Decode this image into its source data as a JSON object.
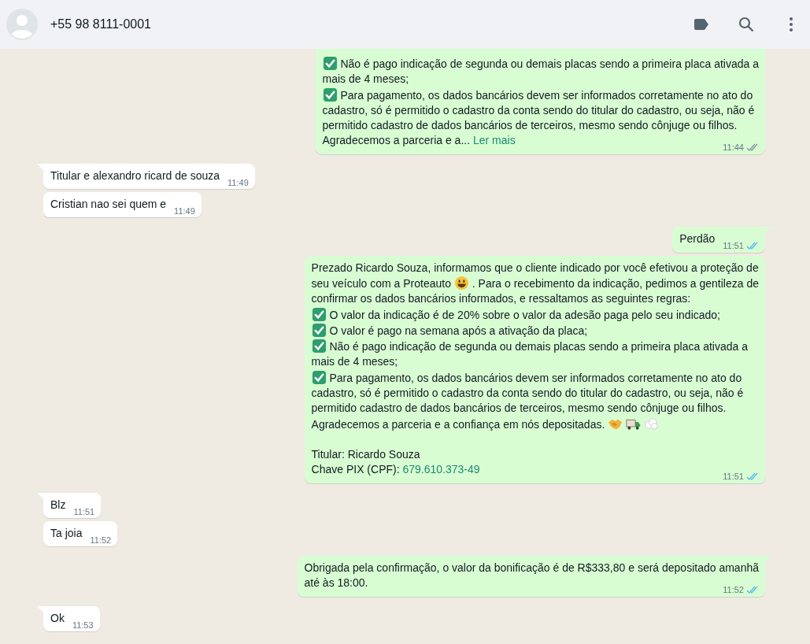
{
  "header": {
    "contact": "+55 98 8111-0001"
  },
  "messages": [
    {
      "outgoing": true,
      "tail": false,
      "clipped": true,
      "time": "11:44",
      "read": false,
      "lines": [
        [
          {
            "kind": "check"
          },
          {
            "kind": "text",
            "text": "Não é pago indicação de segunda ou demais placas sendo a primeira placa ativada a"
          }
        ],
        [
          {
            "kind": "text",
            "text": "mais de 4 meses;"
          }
        ],
        [
          {
            "kind": "check"
          },
          {
            "kind": "text",
            "text": "Para pagamento, os dados bancários devem ser informados corretamente no ato do"
          }
        ],
        [
          {
            "kind": "text",
            "text": "cadastro, só é permitido o cadastro da conta sendo do titular do cadastro, ou seja, não é"
          }
        ],
        [
          {
            "kind": "text",
            "text": "permitido cadastro de dados bancários de terceiros, mesmo sendo cônjuge ou filhos."
          }
        ],
        [
          {
            "kind": "text",
            "text": "Agradecemos a parceria e a..."
          },
          {
            "kind": "link",
            "text": "Ler mais"
          }
        ]
      ]
    },
    {
      "outgoing": false,
      "tail": true,
      "clipped": false,
      "time": "11:49",
      "lines": [
        [
          {
            "kind": "text",
            "text": "Titular e alexandro ricard de souza"
          }
        ]
      ]
    },
    {
      "outgoing": false,
      "tail": false,
      "clipped": false,
      "time": "11:49",
      "lines": [
        [
          {
            "kind": "text",
            "text": "Cristian nao sei quem e"
          }
        ]
      ]
    },
    {
      "outgoing": true,
      "tail": true,
      "clipped": false,
      "time": "11:51",
      "read": true,
      "lines": [
        [
          {
            "kind": "text",
            "text": "Perdão"
          }
        ]
      ]
    },
    {
      "outgoing": true,
      "tail": false,
      "clipped": false,
      "time": "11:51",
      "read": true,
      "lines": [
        [
          {
            "kind": "text",
            "text": "Prezado Ricardo Souza, informamos que o cliente indicado por você efetivou a proteção de"
          }
        ],
        [
          {
            "kind": "text",
            "text": "seu veículo com a Proteauto"
          },
          {
            "kind": "smiley"
          },
          {
            "kind": "text",
            "text": ". Para o recebimento da indicação, pedimos a gentileza de"
          }
        ],
        [
          {
            "kind": "text",
            "text": "confirmar os dados bancários informados, e  ressaltamos as seguintes regras:"
          }
        ],
        [
          {
            "kind": "check"
          },
          {
            "kind": "text",
            "text": "O valor da indicação é de 20% sobre o valor da adesão paga pelo seu indicado;"
          }
        ],
        [
          {
            "kind": "check"
          },
          {
            "kind": "text",
            "text": "O valor é pago na semana após a ativação da placa;"
          }
        ],
        [
          {
            "kind": "check"
          },
          {
            "kind": "text",
            "text": "Não é pago indicação de segunda ou demais placas sendo a primeira placa ativada a"
          }
        ],
        [
          {
            "kind": "text",
            "text": "mais de 4 meses;"
          }
        ],
        [
          {
            "kind": "check"
          },
          {
            "kind": "text",
            "text": "Para pagamento, os dados bancários devem ser informados corretamente no ato do"
          }
        ],
        [
          {
            "kind": "text",
            "text": "cadastro, só é permitido o cadastro da conta sendo do titular do cadastro, ou seja, não é"
          }
        ],
        [
          {
            "kind": "text",
            "text": "permitido cadastro de dados bancários de terceiros, mesmo sendo cônjuge ou filhos."
          }
        ],
        [
          {
            "kind": "text",
            "text": "Agradecemos a parceria e a confiança em nós depositadas."
          },
          {
            "kind": "handshake"
          },
          {
            "kind": "truck"
          },
          {
            "kind": "dash"
          }
        ],
        [
          {
            "kind": "blank"
          }
        ],
        [
          {
            "kind": "text",
            "text": "Titular: Ricardo Souza"
          }
        ],
        [
          {
            "kind": "text",
            "text": "Chave PIX (CPF):"
          },
          {
            "kind": "link",
            "text": "679.610.373-49"
          }
        ]
      ]
    },
    {
      "outgoing": false,
      "tail": true,
      "clipped": false,
      "time": "11:51",
      "lines": [
        [
          {
            "kind": "text",
            "text": "Blz"
          }
        ]
      ]
    },
    {
      "outgoing": false,
      "tail": false,
      "clipped": false,
      "time": "11:52",
      "lines": [
        [
          {
            "kind": "text",
            "text": "Ta joia"
          }
        ]
      ]
    },
    {
      "outgoing": true,
      "tail": true,
      "clipped": false,
      "time": "11:52",
      "read": true,
      "lines": [
        [
          {
            "kind": "text",
            "text": "Obrigada pela confirmação, o valor da bonificação é de R$333,80 e será depositado amanhã"
          }
        ],
        [
          {
            "kind": "text",
            "text": "até às 18:00."
          }
        ]
      ]
    },
    {
      "outgoing": false,
      "tail": true,
      "clipped": false,
      "time": "11:53",
      "lines": [
        [
          {
            "kind": "text",
            "text": "Ok"
          }
        ]
      ]
    }
  ]
}
